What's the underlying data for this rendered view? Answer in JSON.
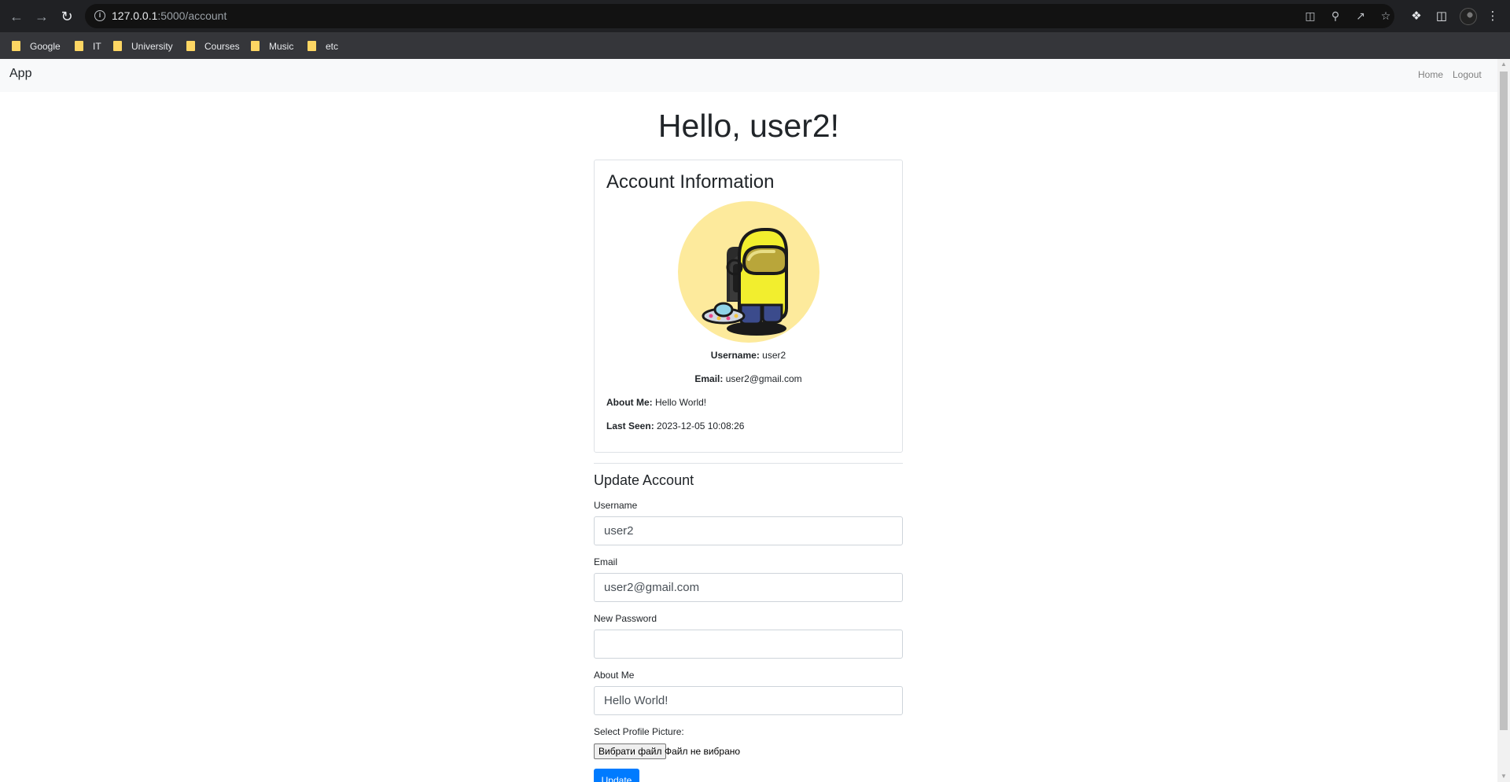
{
  "browser": {
    "url_host": "127.0.0.1",
    "url_path": ":5000/account",
    "bookmarks": [
      "Google",
      "IT",
      "University",
      "Courses",
      "Music",
      "etc"
    ]
  },
  "navbar": {
    "brand": "App",
    "links": [
      "Home",
      "Logout"
    ]
  },
  "greeting": "Hello, user2!",
  "account_info": {
    "title": "Account Information",
    "username_label": "Username:",
    "username": "user2",
    "email_label": "Email:",
    "email": "user2@gmail.com",
    "about_label": "About Me:",
    "about": "Hello World!",
    "last_seen_label": "Last Seen:",
    "last_seen": "2023-12-05 10:08:26"
  },
  "update_form": {
    "title": "Update Account",
    "username_label": "Username",
    "username_value": "user2",
    "email_label": "Email",
    "email_value": "user2@gmail.com",
    "password_label": "New Password",
    "password_value": "",
    "about_label": "About Me",
    "about_value": "Hello World!",
    "picture_label": "Select Profile Picture:",
    "file_button": "Вибрати файл",
    "file_status": "Файл не вибрано",
    "submit": "Update"
  },
  "colors": {
    "primary": "#007bff",
    "avatar_bg": "#fdea9c",
    "navbar_bg": "#f8f9fa"
  }
}
